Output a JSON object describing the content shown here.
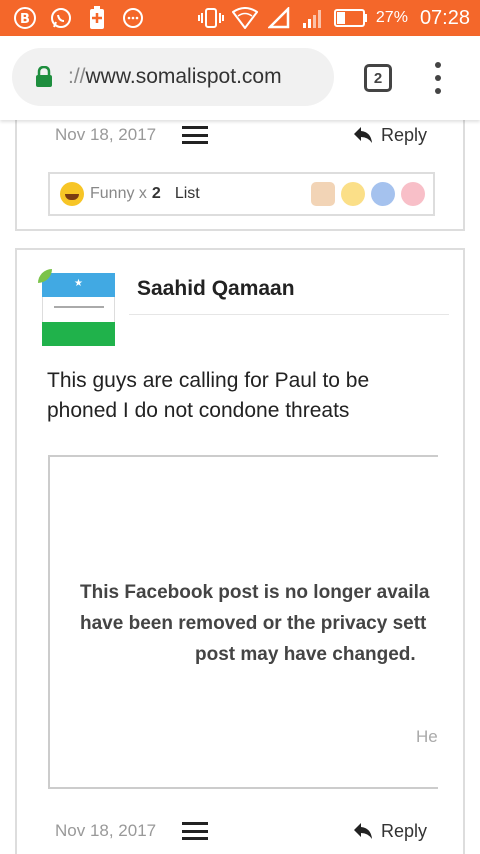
{
  "status_bar": {
    "battery_percent": "27%",
    "time": "07:28",
    "left_icons": [
      "b-badge-icon",
      "whatsapp-icon",
      "battery-charging-icon",
      "chat-bubble-icon"
    ],
    "right_icons": [
      "vibrate-icon",
      "wifi-icon",
      "signal-triangle-icon",
      "signal-bars-icon",
      "battery-icon"
    ]
  },
  "browser": {
    "url_scheme": "://",
    "url_host": "www.somalispot.com",
    "tab_count": "2"
  },
  "post1": {
    "date": "Nov 18, 2017",
    "reply_label": "Reply",
    "reaction_label": "Funny x",
    "reaction_count": "2",
    "list_label": "List"
  },
  "post2": {
    "author": "Saahid Qamaan",
    "body": "This guys are calling for Paul to be phoned I do not condone threats",
    "embed": {
      "line1": "This Facebook post is no longer availa",
      "line2": "have been removed or the privacy sett",
      "line3": "post may have changed.",
      "help": "He"
    },
    "date": "Nov 18, 2017",
    "reply_label": "Reply"
  },
  "colors": {
    "status_bar": "#f4672a",
    "lock_green": "#1e8e3e",
    "flag_blue": "#41a9e3",
    "flag_green": "#20b24b"
  }
}
